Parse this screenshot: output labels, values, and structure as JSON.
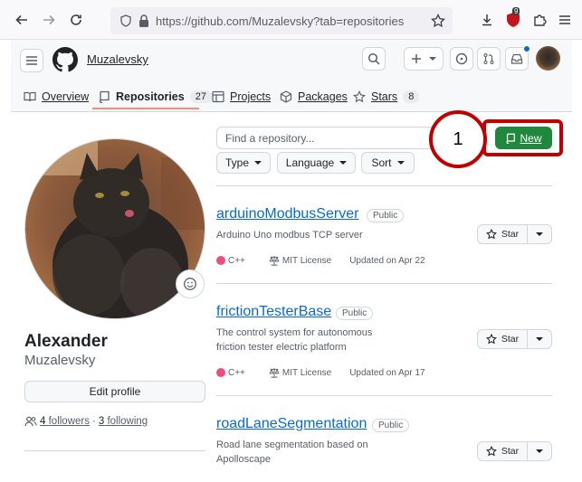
{
  "browser": {
    "url": "https://github.com/Muzalevsky?tab=repositories",
    "notification_badge": "9"
  },
  "header": {
    "username": "Muzalevsky",
    "tabs": [
      {
        "label": "Overview"
      },
      {
        "label": "Repositories",
        "count": "27"
      },
      {
        "label": "Projects"
      },
      {
        "label": "Packages"
      },
      {
        "label": "Stars",
        "count": "8"
      }
    ]
  },
  "profile": {
    "full_name": "Alexander",
    "login": "Muzalevsky",
    "edit_label": "Edit profile",
    "followers_count": "4",
    "followers_label": "followers",
    "separator": "·",
    "following_count": "3",
    "following_label": "following"
  },
  "repo_controls": {
    "find_placeholder": "Find a repository...",
    "type_label": "Type",
    "language_label": "Language",
    "sort_label": "Sort",
    "new_label": "New"
  },
  "annotation": {
    "number": "1",
    "color": "#c00000"
  },
  "repos": [
    {
      "name": "arduinoModbusServer",
      "visibility": "Public",
      "description": "Arduino Uno modbus TCP server",
      "language": "C++",
      "license": "MIT License",
      "updated": "Updated on Apr 22",
      "star_label": "Star"
    },
    {
      "name": "frictionTesterBase",
      "visibility": "Public",
      "description": "The control system for autonomous friction tester electric platform",
      "language": "C++",
      "license": "MIT License",
      "updated": "Updated on Apr 17",
      "star_label": "Star"
    },
    {
      "name": "roadLaneSegmentation",
      "visibility": "Public",
      "description": "Road lane segmentation based on Apolloscape",
      "star_label": "Star"
    }
  ],
  "colors": {
    "new_button": "#1f883d",
    "link": "#0969da",
    "tab_underline": "#fd8c73",
    "cpp_language": "#f34b7d"
  }
}
